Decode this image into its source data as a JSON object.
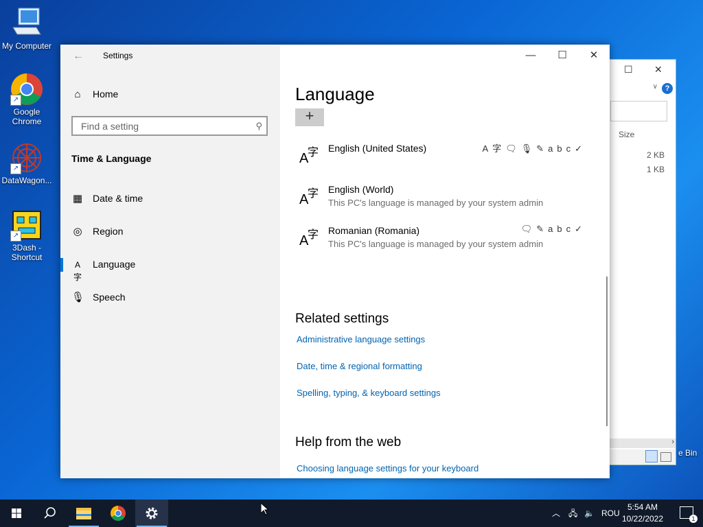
{
  "desktop": {
    "icons": [
      {
        "label": "My Computer"
      },
      {
        "label": "Google Chrome"
      },
      {
        "label": "DataWagon..."
      },
      {
        "label": "3Dash - Shortcut"
      }
    ]
  },
  "background_window": {
    "column_header": "Size",
    "sizes": [
      "2 KB",
      "1 KB"
    ],
    "recycle_label": "e Bin"
  },
  "settings": {
    "app_title": "Settings",
    "home_label": "Home",
    "search_placeholder": "Find a setting",
    "section_title": "Time & Language",
    "nav": [
      {
        "label": "Date & time",
        "icon": "calendar-clock-icon"
      },
      {
        "label": "Region",
        "icon": "globe-icon"
      },
      {
        "label": "Language",
        "icon": "language-icon",
        "selected": true
      },
      {
        "label": "Speech",
        "icon": "microphone-icon"
      }
    ],
    "page_title": "Language",
    "languages": [
      {
        "name": "English (United States)",
        "subtitle": "",
        "features": [
          "A字",
          "🗨",
          "🎙",
          "✎",
          "abc✓"
        ]
      },
      {
        "name": "English (World)",
        "subtitle": "This PC's language is managed by your system admin",
        "features": []
      },
      {
        "name": "Romanian (Romania)",
        "subtitle": "This PC's language is managed by your system admin",
        "features": [
          "🗨",
          "✎",
          "abc✓"
        ]
      }
    ],
    "related_title": "Related settings",
    "related_links": [
      "Administrative language settings",
      "Date, time & regional formatting",
      "Spelling, typing, & keyboard settings"
    ],
    "help_title": "Help from the web",
    "help_links": [
      "Choosing language settings for your keyboard"
    ]
  },
  "taskbar": {
    "lang_indicator": "ROU",
    "time": "5:54 AM",
    "date": "10/22/2022",
    "notification_count": "1"
  }
}
